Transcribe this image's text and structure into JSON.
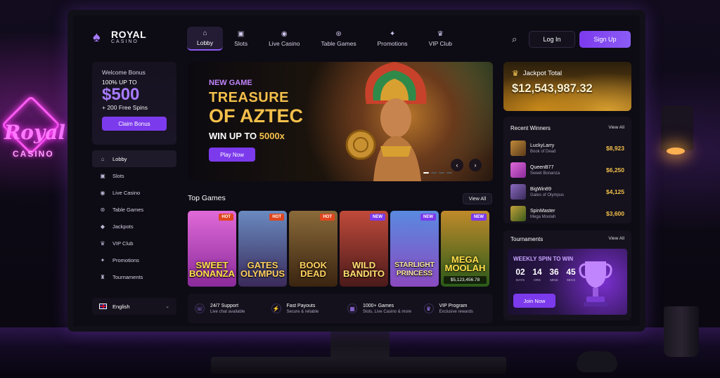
{
  "brand": {
    "name": "ROYAL",
    "sub": "CASINO",
    "color": "#8b5cf6"
  },
  "nav": {
    "items": [
      {
        "label": "Lobby",
        "icon": "home-icon"
      },
      {
        "label": "Slots",
        "icon": "slot-icon"
      },
      {
        "label": "Live Casino",
        "icon": "live-icon"
      },
      {
        "label": "Table Games",
        "icon": "chip-icon"
      },
      {
        "label": "Promotions",
        "icon": "gift-icon"
      },
      {
        "label": "VIP Club",
        "icon": "crown-icon"
      }
    ],
    "active": "Lobby",
    "login": "Log In",
    "signup": "Sign Up"
  },
  "bonus": {
    "title": "Welcome Bonus",
    "line": "100% UP TO",
    "amount": "$500",
    "spins": "+ 200 Free Spins",
    "button": "Claim Bonus"
  },
  "sidebar": {
    "items": [
      {
        "label": "Lobby",
        "icon": "home-icon"
      },
      {
        "label": "Slots",
        "icon": "slot-icon"
      },
      {
        "label": "Live Casino",
        "icon": "live-icon"
      },
      {
        "label": "Table Games",
        "icon": "chip-icon"
      },
      {
        "label": "Jackpots",
        "icon": "jackpot-icon"
      },
      {
        "label": "VIP Club",
        "icon": "crown-icon"
      },
      {
        "label": "Promotions",
        "icon": "gift-icon"
      },
      {
        "label": "Tournaments",
        "icon": "trophy-icon"
      }
    ],
    "language": "English"
  },
  "hero": {
    "tag": "NEW GAME",
    "title1": "TREASURE",
    "title2": "OF AZTEC",
    "win_prefix": "WIN UP TO",
    "win_value": "5000x",
    "button": "Play Now"
  },
  "top_games": {
    "title": "Top Games",
    "view_all": "View All",
    "games": [
      {
        "name": "SWEET BONANZA",
        "badge": "HOT",
        "bg": "#b84fb8"
      },
      {
        "name": "GATES OLYMPUS",
        "badge": "HOT",
        "bg": "#5a4a7a"
      },
      {
        "name": "BOOK DEAD",
        "badge": "HOT",
        "bg": "#5a3a1e"
      },
      {
        "name": "WILD BANDITO",
        "badge": "NEW",
        "bg": "#8a2a2a"
      },
      {
        "name": "STARLIGHT PRINCESS",
        "badge": "NEW",
        "bg": "#6a4ab0"
      },
      {
        "name": "MEGA MOOLAH",
        "badge": "NEW",
        "bg": "#3a6a2a",
        "jackpot": "$5,123,456.78"
      }
    ]
  },
  "features": [
    {
      "title": "24/7 Support",
      "sub": "Live chat available",
      "icon": "support-icon"
    },
    {
      "title": "Fast Payouts",
      "sub": "Secure & reliable",
      "icon": "payout-icon"
    },
    {
      "title": "1000+ Games",
      "sub": "Slots, Live Casino & more",
      "icon": "games-icon"
    },
    {
      "title": "VIP Program",
      "sub": "Exclusive rewards",
      "icon": "vip-icon"
    }
  ],
  "jackpot": {
    "label": "Jackpot Total",
    "value": "$12,543,987.32"
  },
  "winners": {
    "title": "Recent Winners",
    "view_all": "View All",
    "items": [
      {
        "name": "LuckyLarry",
        "game": "Book of Dead",
        "amount": "$8,923"
      },
      {
        "name": "QueenB77",
        "game": "Sweet Bonanza",
        "amount": "$6,250"
      },
      {
        "name": "BigWin89",
        "game": "Gates of Olympus",
        "amount": "$4,125"
      },
      {
        "name": "SpinMaster",
        "game": "Mega Moolah",
        "amount": "$3,600"
      }
    ]
  },
  "tournaments": {
    "title": "Tournaments",
    "view_all": "View All",
    "event": "WEEKLY SPIN TO WIN",
    "countdown": [
      {
        "value": "02",
        "unit": "DAYS"
      },
      {
        "value": "14",
        "unit": "HRS"
      },
      {
        "value": "36",
        "unit": "MINS"
      },
      {
        "value": "45",
        "unit": "SECS"
      }
    ],
    "button": "Join Now"
  },
  "neon_sign": {
    "text": "Royal",
    "sub": "CASINO"
  }
}
